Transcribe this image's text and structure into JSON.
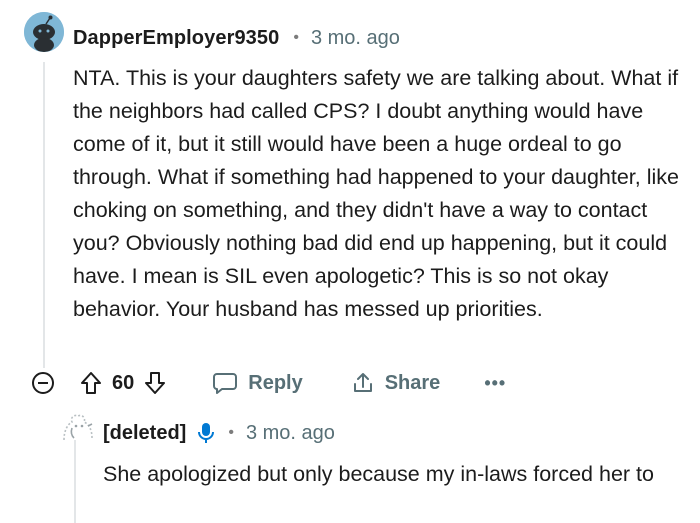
{
  "comment": {
    "username": "DapperEmployer9350",
    "separator": "•",
    "time": "3 mo. ago",
    "body": "NTA. This is your daughters safety we are talking about. What if the neighbors had called CPS? I doubt anything would have come of it, but it still would have been a huge ordeal to go through. What if something had happened to your daughter, like choking on something, and they didn't have a way to contact you? Obviously nothing bad did end up happening, but it could have. I mean is SIL even apologetic? This is so not okay behavior. Your husband has messed up priorities.",
    "avatar_icon": "snoo-avatar-icon"
  },
  "actions": {
    "vote_count": "60",
    "reply_label": "Reply",
    "share_label": "Share",
    "more_label": "•••",
    "icons": [
      "collapse-icon",
      "upvote-icon",
      "downvote-icon",
      "comment-bubble-icon",
      "share-icon",
      "more-icon"
    ]
  },
  "reply": {
    "username": "[deleted]",
    "separator": "•",
    "time": "3 mo. ago",
    "body": "She apologized but only because my in-laws forced her to",
    "avatar_icon": "deleted-user-icon",
    "badge_icon": "mic-icon"
  },
  "colors": {
    "text": "#1c1c1c",
    "meta": "#576f76",
    "thread_line": "#e3e6e8",
    "avatar_bg": "#7fb7d6",
    "mic_blue": "#0079d3"
  }
}
